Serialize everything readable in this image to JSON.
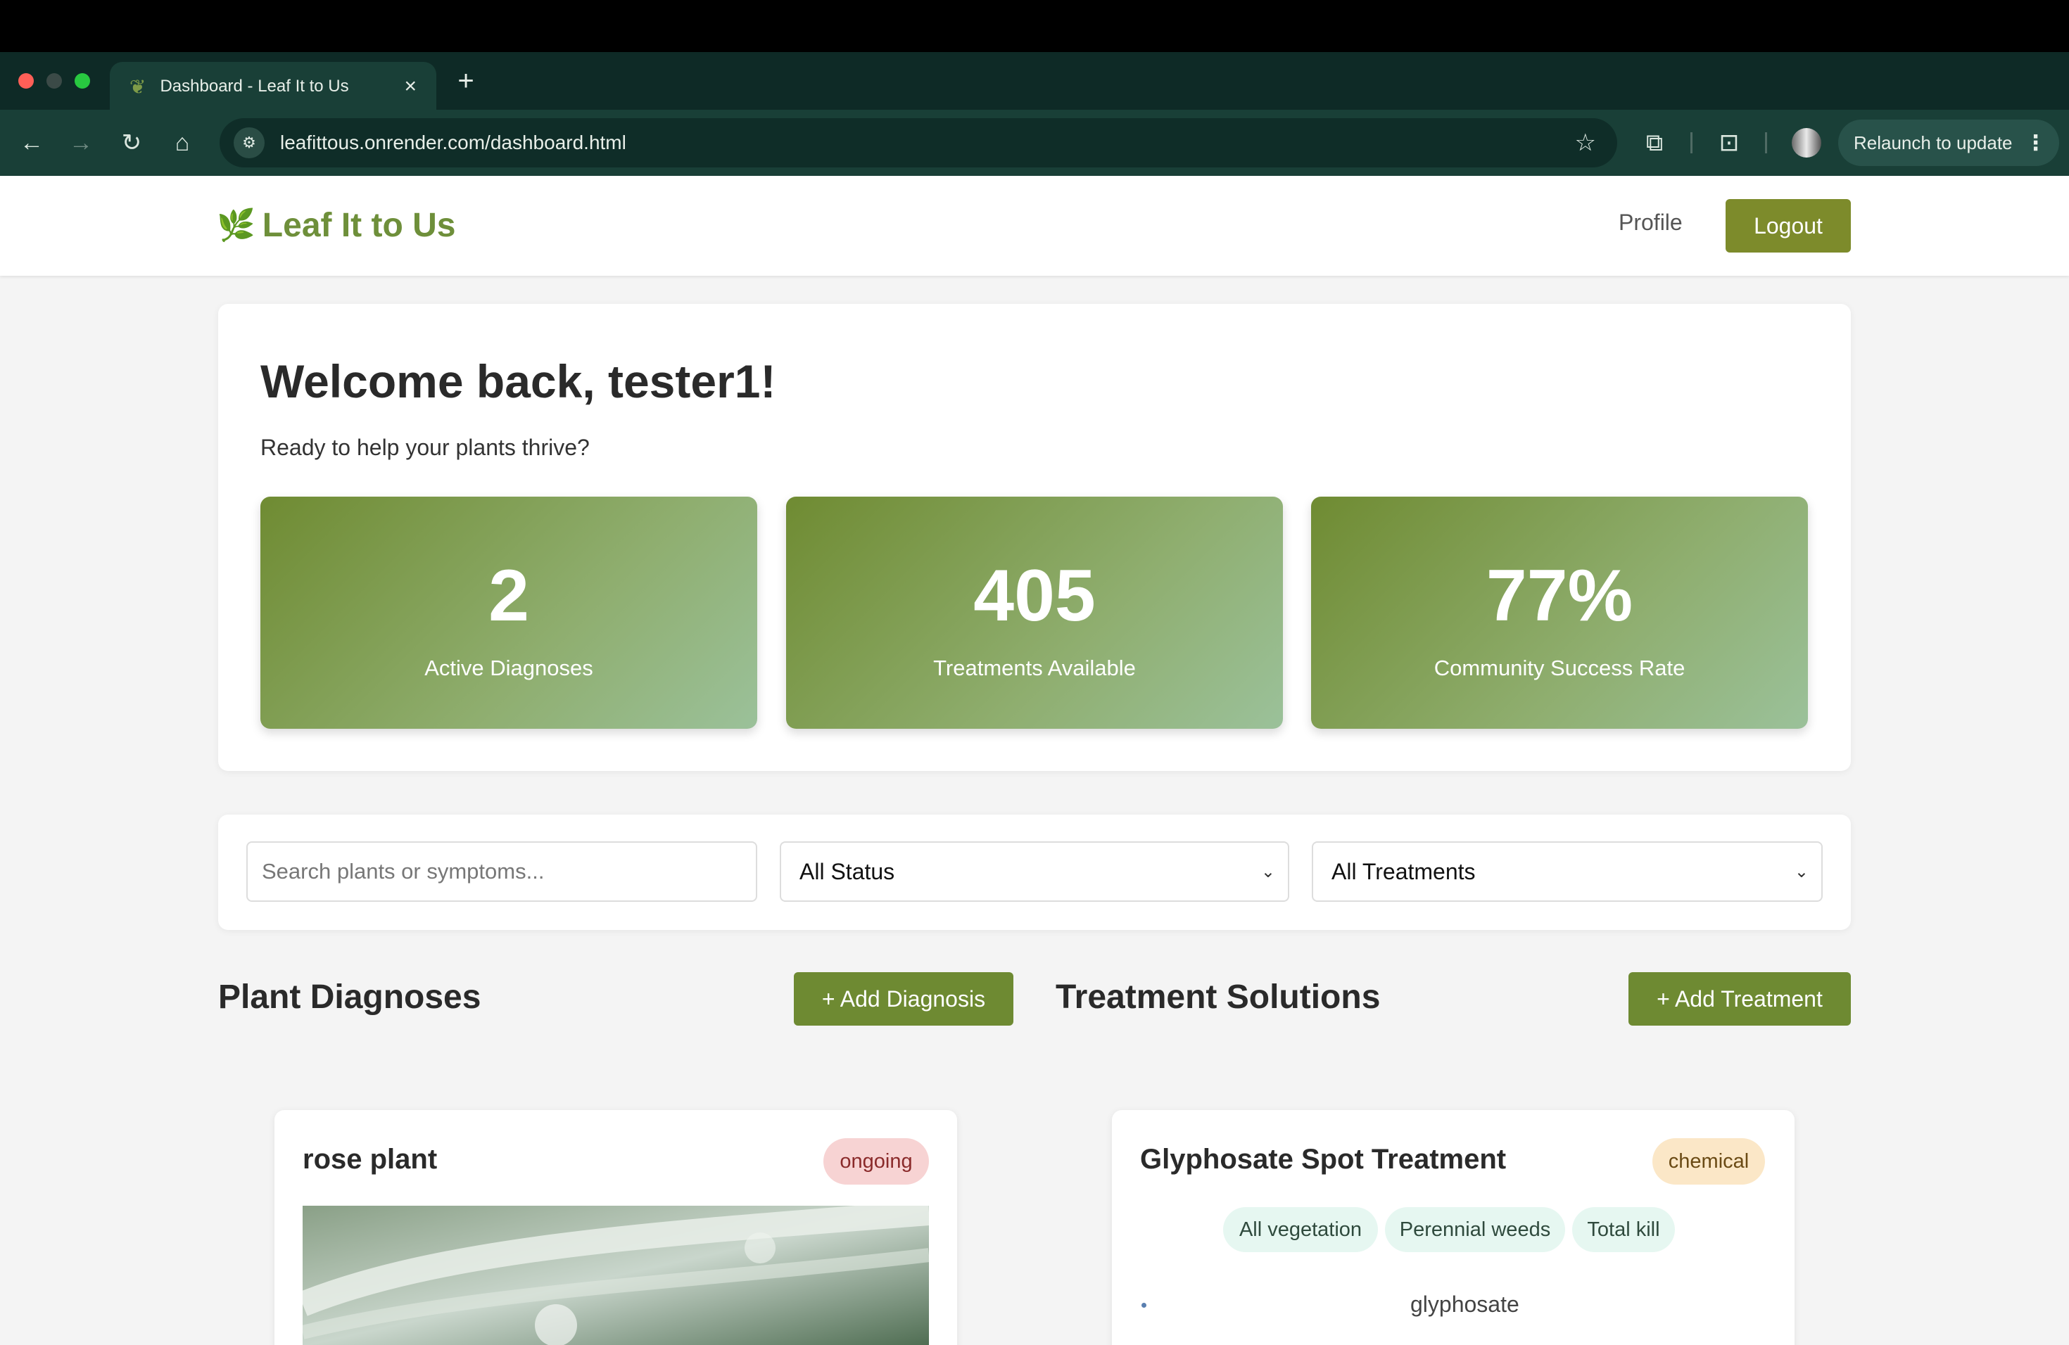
{
  "browser": {
    "tab_title": "Dashboard - Leaf It to Us",
    "url": "leafittous.onrender.com/dashboard.html",
    "relaunch_label": "Relaunch to update"
  },
  "header": {
    "brand": "Leaf It to Us",
    "profile_link": "Profile",
    "logout_label": "Logout"
  },
  "welcome": {
    "title": "Welcome back, tester1!",
    "subtitle": "Ready to help your plants thrive?"
  },
  "stats": [
    {
      "value": "2",
      "label": "Active Diagnoses"
    },
    {
      "value": "405",
      "label": "Treatments Available"
    },
    {
      "value": "77%",
      "label": "Community Success Rate"
    }
  ],
  "filters": {
    "search_placeholder": "Search plants or symptoms...",
    "status_selected": "All Status",
    "treatment_selected": "All Treatments"
  },
  "diagnoses": {
    "title": "Plant Diagnoses",
    "add_label": "+ Add Diagnosis",
    "items": [
      {
        "name": "rose plant",
        "status": "ongoing"
      }
    ]
  },
  "treatments": {
    "title": "Treatment Solutions",
    "add_label": "+ Add Treatment",
    "items": [
      {
        "name": "Glyphosate Spot Treatment",
        "type": "chemical",
        "tags": [
          "All vegetation",
          "Perennial weeds",
          "Total kill"
        ],
        "ingredients": [
          "glyphosate"
        ]
      }
    ]
  },
  "colors": {
    "brand_green": "#6e8f3a",
    "button_olive": "#7d8b2b",
    "add_button_green": "#6e8a32",
    "ongoing_badge_bg": "#f7d3d3",
    "chemical_badge_bg": "#fbe7c7",
    "tag_bg": "#e6f7f1"
  }
}
